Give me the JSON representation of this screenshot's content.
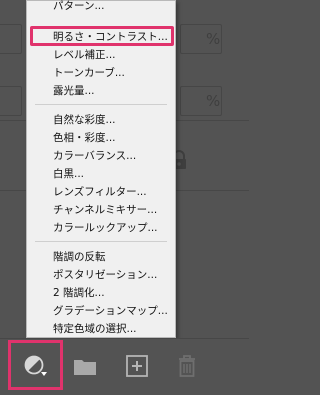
{
  "menu": {
    "items": [
      {
        "label": "パターン..."
      },
      {
        "label": "明るさ・コントラスト..."
      },
      {
        "label": "レベル補正..."
      },
      {
        "label": "トーンカーブ..."
      },
      {
        "label": "露光量..."
      },
      {
        "label": "自然な彩度..."
      },
      {
        "label": "色相・彩度..."
      },
      {
        "label": "カラーバランス..."
      },
      {
        "label": "白黒..."
      },
      {
        "label": "レンズフィルター..."
      },
      {
        "label": "チャンネルミキサー..."
      },
      {
        "label": "カラールックアップ..."
      },
      {
        "label": "階調の反転"
      },
      {
        "label": "ポスタリゼーション..."
      },
      {
        "label": "2 階調化..."
      },
      {
        "label": "グラデーションマップ..."
      },
      {
        "label": "特定色域の選択..."
      }
    ],
    "highlighted_index": 1
  },
  "background": {
    "percent_1": "%",
    "percent_2": "%"
  },
  "toolbar": {
    "icons": [
      "adjustment-layer-icon",
      "folder-icon",
      "new-layer-icon",
      "trash-icon"
    ]
  },
  "colors": {
    "highlight": "#e0336c",
    "panel": "#535353",
    "menu_bg": "#f0f0f0"
  }
}
